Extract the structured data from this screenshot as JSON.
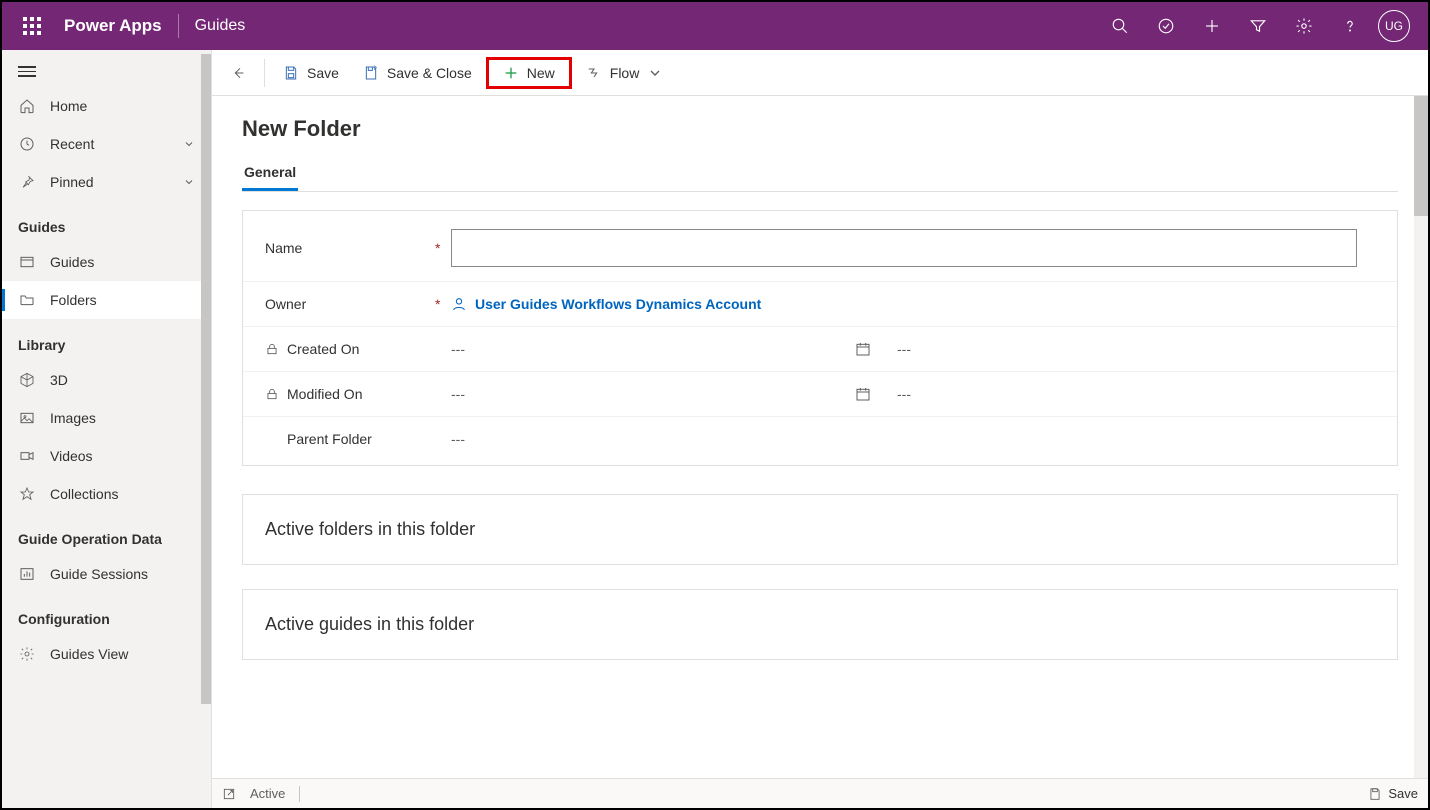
{
  "header": {
    "app_name": "Power Apps",
    "section": "Guides",
    "avatar_initials": "UG"
  },
  "sidebar": {
    "home": "Home",
    "recent": "Recent",
    "pinned": "Pinned",
    "groups": {
      "guides_title": "Guides",
      "guides": "Guides",
      "folders": "Folders",
      "library_title": "Library",
      "three_d": "3D",
      "images": "Images",
      "videos": "Videos",
      "collections": "Collections",
      "god_title": "Guide Operation Data",
      "guide_sessions": "Guide Sessions",
      "config_title": "Configuration",
      "guides_view": "Guides View"
    }
  },
  "commands": {
    "save": "Save",
    "save_close": "Save & Close",
    "new": "New",
    "flow": "Flow"
  },
  "page": {
    "title": "New Folder",
    "tab_general": "General",
    "name_label": "Name",
    "owner_label": "Owner",
    "owner_value": "User Guides Workflows Dynamics Account",
    "created_label": "Created On",
    "modified_label": "Modified On",
    "parent_label": "Parent Folder",
    "empty_dash": "---",
    "active_folders": "Active folders in this folder",
    "active_guides": "Active guides in this folder"
  },
  "status": {
    "state": "Active",
    "save": "Save"
  }
}
